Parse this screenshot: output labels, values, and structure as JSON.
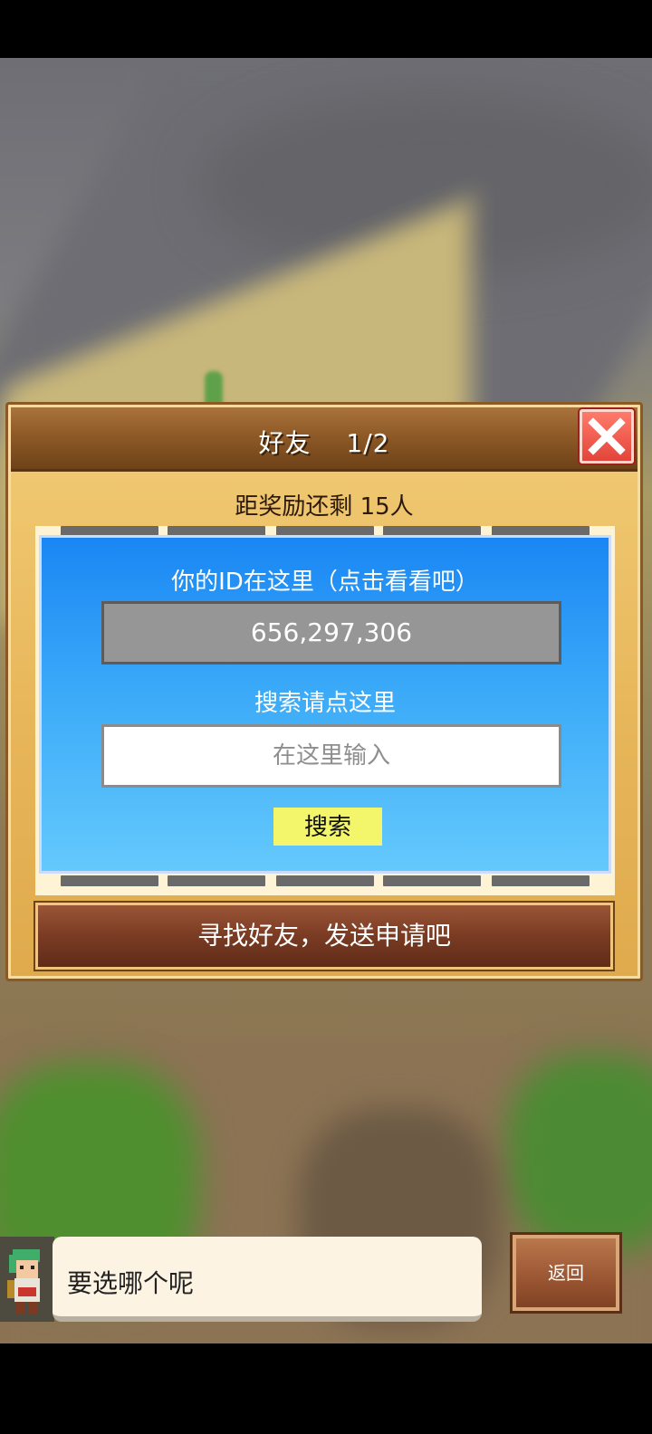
{
  "dialog": {
    "title": "好友　 1/2",
    "reward_text": "距奖励还剩 15人",
    "id_label": "你的ID在这里（点击看看吧）",
    "id_value": "656,297,306",
    "search_label": "搜索请点这里",
    "search_placeholder": "在这里输入",
    "search_button": "搜索",
    "find_friends_button": "寻找好友，发送申请吧"
  },
  "message": {
    "text": "要选哪个呢"
  },
  "back_button": "返回",
  "icons": {
    "close": "close-icon",
    "left_arrow": "arrow-left-icon",
    "right_arrow": "arrow-right-icon",
    "avatar": "character-avatar"
  },
  "colors": {
    "dialog_gold": "#e8b65a",
    "header_brown": "#8e5a27",
    "card_blue": "#3aa9f8",
    "search_yellow": "#f3f56a",
    "close_red": "#e3453a"
  }
}
